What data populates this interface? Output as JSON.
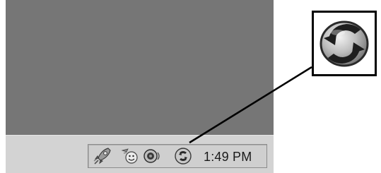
{
  "taskbar": {
    "clock": "1:49 PM"
  },
  "tray_icons": [
    {
      "name": "rocket-icon"
    },
    {
      "name": "messenger-icon"
    },
    {
      "name": "speaker-icon"
    },
    {
      "name": "sync-icon"
    }
  ],
  "callout": {
    "icon": "sync-icon"
  },
  "colors": {
    "desktop": "#767676",
    "taskbar": "#d3d3d3",
    "callout_border": "#000000"
  }
}
